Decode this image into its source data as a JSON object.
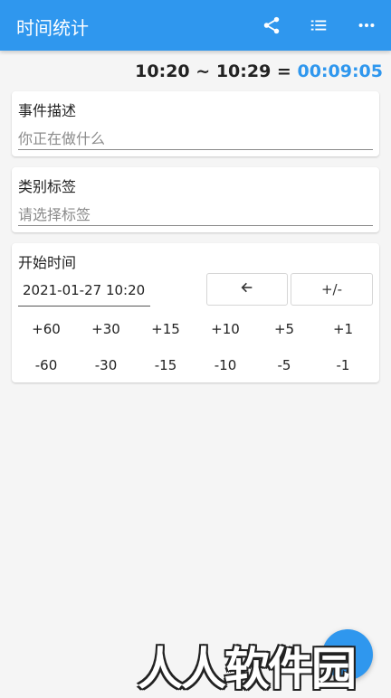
{
  "appbar": {
    "title": "时间统计",
    "actions": [
      {
        "icon": "share-icon"
      },
      {
        "icon": "list-icon"
      },
      {
        "icon": "more-vert-icon"
      }
    ]
  },
  "summary": {
    "start": "10:20",
    "separator": "~",
    "end": "10:29",
    "equals": "=",
    "duration": "00:09:05",
    "duration_color": "#2f97ee"
  },
  "event": {
    "label": "事件描述",
    "placeholder": "你正在做什么"
  },
  "category": {
    "label": "类别标签",
    "placeholder": "请选择标签"
  },
  "start_time": {
    "label": "开始时间",
    "value": "2021-01-27 10:20",
    "back_icon": "arrow-left-icon",
    "toggle_label": "+/-",
    "plus_offsets": [
      "+60",
      "+30",
      "+15",
      "+10",
      "+5",
      "+1"
    ],
    "minus_offsets": [
      "-60",
      "-30",
      "-15",
      "-10",
      "-5",
      "-1"
    ]
  },
  "fab": {
    "icon": "fab-icon"
  },
  "watermark": "人人软件园",
  "colors": {
    "primary": "#2f97ee",
    "background": "#f5f5f5"
  }
}
